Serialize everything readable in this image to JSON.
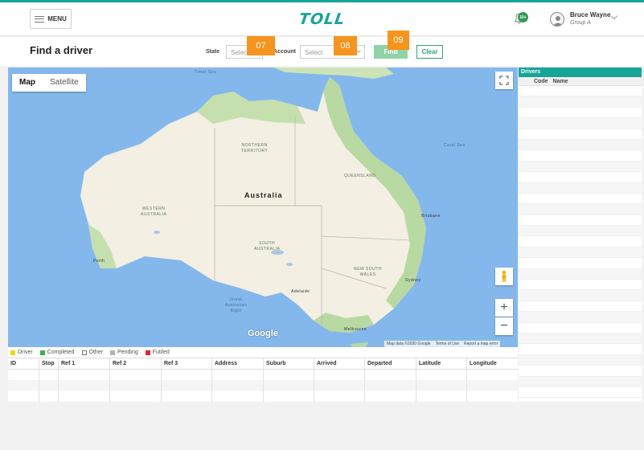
{
  "header": {
    "menu_label": "MENU",
    "logo_text": "TOLL",
    "notification_badge": "10+",
    "user_name": "Bruce Wayne",
    "user_group": "Group A"
  },
  "toolbar": {
    "title": "Find a driver",
    "state_label": "State",
    "state_placeholder": "Select",
    "account_label": "Account",
    "account_placeholder": "Select",
    "find_label": "Find",
    "clear_label": "Clear"
  },
  "callouts": [
    "07",
    "08",
    "09"
  ],
  "map": {
    "tabs": [
      "Map",
      "Satellite"
    ],
    "labels": {
      "timor_sea": "Timor Sea",
      "coral_sea": "Coral Sea",
      "northern_territory": "NORTHERN\nTERRITORY",
      "queensland": "QUEENSLAND",
      "western_australia": "WESTERN\nAUSTRALIA",
      "south_australia": "SOUTH\nAUSTRALIA",
      "new_south_wales": "NEW SOUTH\nWALES",
      "australia": "Australia",
      "great_bight": "Great\nAustralian\nBight",
      "perth": "Perth",
      "adelaide": "Adelaide",
      "melbourne": "Melbourne",
      "sydney": "Sydney",
      "brisbane": "Brisbane"
    },
    "google_logo": "Google",
    "attribution": [
      "Map data ©2020 Google",
      "Terms of Use",
      "Report a map error"
    ]
  },
  "legend": [
    {
      "label": "Driver",
      "color": "#f5d70a"
    },
    {
      "label": "Completed",
      "color": "#3cb44a"
    },
    {
      "label": "Other",
      "color": "#ffffff"
    },
    {
      "label": "Pending",
      "color": "#b3b3b3"
    },
    {
      "label": "Futiled",
      "color": "#e0282e"
    }
  ],
  "table": {
    "columns": [
      "ID",
      "Stop",
      "Ref 1",
      "Ref 2",
      "Ref 3",
      "Address",
      "Suburb",
      "Arrived",
      "Departed",
      "Latitude",
      "Longitude"
    ]
  },
  "drivers_panel": {
    "title": "Drivers",
    "columns": [
      "Code",
      "Name"
    ]
  },
  "colors": {
    "brand": "#17a59a",
    "callout": "#f7941d",
    "find_button": "#8fd4a4"
  }
}
